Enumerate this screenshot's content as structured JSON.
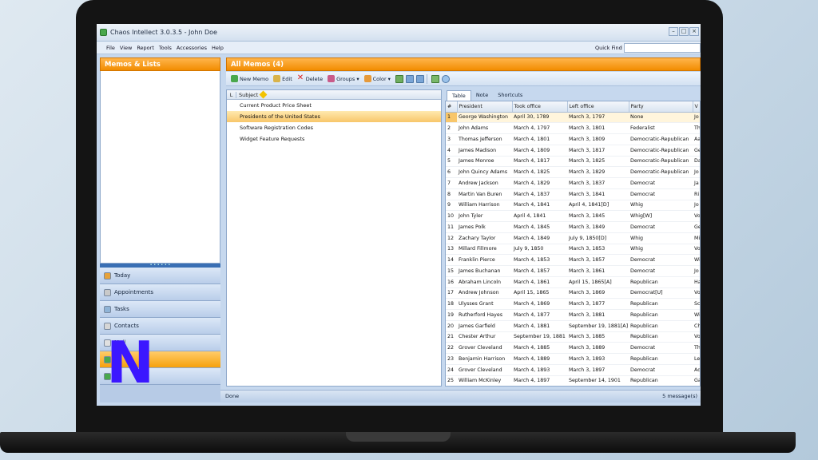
{
  "window": {
    "title": "Chaos Intellect 3.0.3.5 - John Doe"
  },
  "menu": {
    "items": [
      "File",
      "View",
      "Report",
      "Tools",
      "Accessories",
      "Help"
    ],
    "quick_find_label": "Quick Find",
    "quick_find_value": ""
  },
  "left_panel": {
    "header": "Memos & Lists",
    "nav": [
      {
        "label": "Today",
        "color": "#e7a23a"
      },
      {
        "label": "Appointments",
        "color": "#c9c9c9"
      },
      {
        "label": "Tasks",
        "color": "#8fb3d6"
      },
      {
        "label": "Contacts",
        "color": "#d6d6d6"
      },
      {
        "label": "Mail",
        "color": "#e0e0e0"
      },
      {
        "label": "",
        "color": "#4aa84d"
      },
      {
        "label": "",
        "color": "#4aa84d"
      }
    ],
    "footer_glyph": "»"
  },
  "main": {
    "header": "All Memos (4)",
    "toolbar": {
      "new_memo": "New Memo",
      "edit": "Edit",
      "delete": "Delete",
      "groups": "Groups ▾",
      "color": "Color ▾"
    },
    "subject_header_l": "L",
    "subject_header": "Subject",
    "subjects": [
      {
        "text": "Current Product Price Sheet",
        "selected": false
      },
      {
        "text": "Presidents of the United States",
        "selected": true
      },
      {
        "text": "Software Registration Codes",
        "selected": false
      },
      {
        "text": "Widget Feature Requests",
        "selected": false
      }
    ]
  },
  "tabs": [
    "Table",
    "Note",
    "Shortcuts"
  ],
  "table": {
    "headers": [
      "#",
      "President",
      "Took office",
      "Left office",
      "Party",
      "V"
    ],
    "rows": [
      [
        "1",
        "George Washington",
        "April 30, 1789",
        "March 3, 1797",
        "None",
        "Jo"
      ],
      [
        "2",
        "John Adams",
        "March 4, 1797",
        "March 3, 1801",
        "Federalist",
        "Th"
      ],
      [
        "3",
        "Thomas Jefferson",
        "March 4, 1801",
        "March 3, 1809",
        "Democratic-Republican",
        "Aa"
      ],
      [
        "4",
        "James Madison",
        "March 4, 1809",
        "March 3, 1817",
        "Democratic-Republican",
        "Ge"
      ],
      [
        "5",
        "James Monroe",
        "March 4, 1817",
        "March 3, 1825",
        "Democratic-Republican",
        "Da"
      ],
      [
        "6",
        "John Quincy Adams",
        "March 4, 1825",
        "March 3, 1829",
        "Democratic-Republican",
        "Jo"
      ],
      [
        "7",
        "Andrew Jackson",
        "March 4, 1829",
        "March 3, 1837",
        "Democrat",
        "Ja"
      ],
      [
        "8",
        "Martin Van Buren",
        "March 4, 1837",
        "March 3, 1841",
        "Democrat",
        "Ri"
      ],
      [
        "9",
        "William Harrison",
        "March 4, 1841",
        "April 4, 1841[D]",
        "Whig",
        "Jo"
      ],
      [
        "10",
        "John Tyler",
        "April 4, 1841",
        "March 3, 1845",
        "Whig[W]",
        "Vo"
      ],
      [
        "11",
        "James Polk",
        "March 4, 1845",
        "March 3, 1849",
        "Democrat",
        "Ge"
      ],
      [
        "12",
        "Zachary Taylor",
        "March 4, 1849",
        "July 9, 1850[D]",
        "Whig",
        "Mi"
      ],
      [
        "13",
        "Millard Fillmore",
        "July 9, 1850",
        "March 3, 1853",
        "Whig",
        "Vo"
      ],
      [
        "14",
        "Franklin Pierce",
        "March 4, 1853",
        "March 3, 1857",
        "Democrat",
        "Wi"
      ],
      [
        "15",
        "James Buchanan",
        "March 4, 1857",
        "March 3, 1861",
        "Democrat",
        "Jo"
      ],
      [
        "16",
        "Abraham Lincoln",
        "March 4, 1861",
        "April 15, 1865[A]",
        "Republican",
        "Ha"
      ],
      [
        "17",
        "Andrew Johnson",
        "April 15, 1865",
        "March 3, 1869",
        "Democrat[U]",
        "Vo"
      ],
      [
        "18",
        "Ulysses Grant",
        "March 4, 1869",
        "March 3, 1877",
        "Republican",
        "Sc"
      ],
      [
        "19",
        "Rutherford Hayes",
        "March 4, 1877",
        "March 3, 1881",
        "Republican",
        "Wi"
      ],
      [
        "20",
        "James Garfield",
        "March 4, 1881",
        "September 19, 1881[A]",
        "Republican",
        "Ch"
      ],
      [
        "21",
        "Chester Arthur",
        "September 19, 1881",
        "March 3, 1885",
        "Republican",
        "Vo"
      ],
      [
        "22",
        "Grover Cleveland",
        "March 4, 1885",
        "March 3, 1889",
        "Democrat",
        "Th"
      ],
      [
        "23",
        "Benjamin Harrison",
        "March 4, 1889",
        "March 3, 1893",
        "Republican",
        "Le"
      ],
      [
        "24",
        "Grover Cleveland",
        "March 4, 1893",
        "March 3, 1897",
        "Democrat",
        "Ad"
      ],
      [
        "25",
        "William McKinley",
        "March 4, 1897",
        "September 14, 1901",
        "Republican",
        "Ga"
      ]
    ]
  },
  "status": {
    "text": "Done",
    "messages": "5 message(s)"
  },
  "watermark": "N"
}
